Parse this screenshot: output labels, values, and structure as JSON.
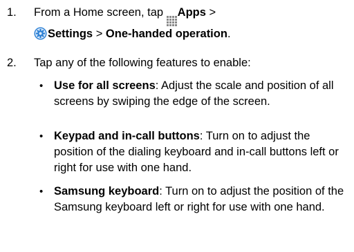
{
  "steps": [
    {
      "number": "1.",
      "text_prefix": "From a Home screen, tap",
      "apps_label": "Apps",
      "sep1": ">",
      "settings_label": "Settings",
      "sep2": ">",
      "target_label": "One-handed operation",
      "end": "."
    },
    {
      "number": "2.",
      "text": "Tap any of the following features to enable:"
    }
  ],
  "bullets": [
    {
      "dot": "•",
      "title": "Use for all screens",
      "desc": ": Adjust the scale and position of all screens by swiping the edge of the screen."
    },
    {
      "dot": "•",
      "title": "Keypad and in-call buttons",
      "desc": ": Turn on to adjust the position of the dialing keyboard and in-call buttons left or right for use with one hand."
    },
    {
      "dot": "•",
      "title": "Samsung keyboard",
      "desc": ": Turn on to adjust the position of the Samsung keyboard left or right for use with one hand."
    }
  ],
  "icons": {
    "apps": "apps-grid-icon",
    "settings": "settings-gear-icon",
    "settings_color": "#2a7fd4"
  }
}
